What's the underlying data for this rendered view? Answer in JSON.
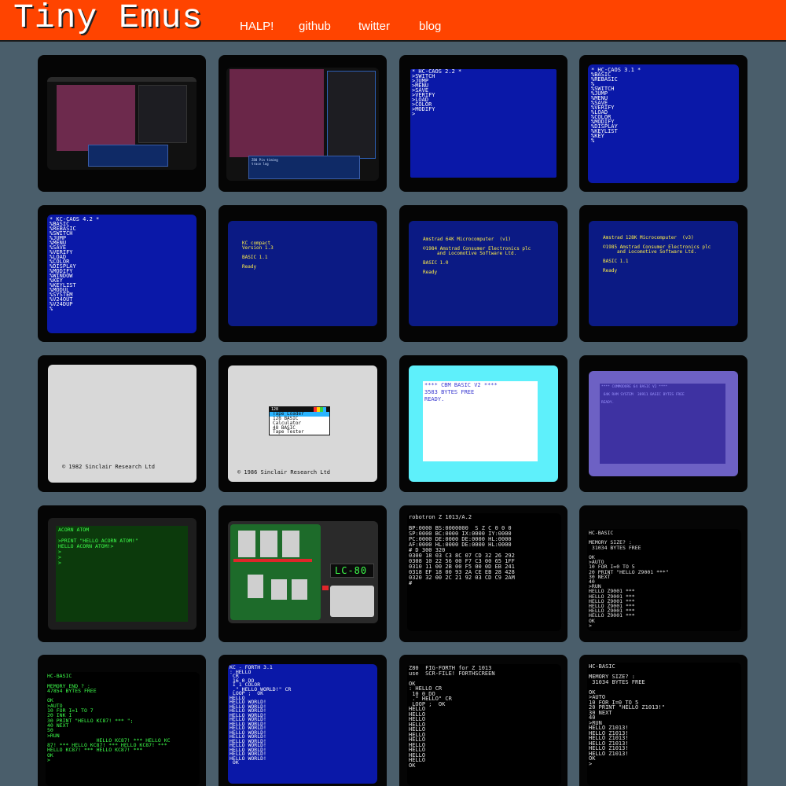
{
  "site": {
    "title": "Tiny Emus"
  },
  "nav": [
    {
      "label": "HALP!"
    },
    {
      "label": "github"
    },
    {
      "label": "twitter"
    },
    {
      "label": "blog"
    }
  ],
  "tiles": [
    {
      "text": ""
    },
    {
      "text": "Z80 Pin timing\ntrace log"
    },
    {
      "text": "* HC-CAOS 2.2 *\n>SWITCH\n>JUMP\n>MENU\n>SAVE\n>VERIFY\n>LOAD\n>COLOR\n>MODIFY\n>"
    },
    {
      "text": "* HC-CAOS 3.1 *\n%BASIC\n%REBASIC\n%\n%SWITCH\n%JUMP\n%MENU\n%SAVE\n%VERIFY\n%LOAD\n%COLOR\n%MODIFY\n%DISPLAY\n%KEYLIST\n%KEY\n%"
    },
    {
      "text": "* KC-CAOS 4.2 *\n%BASIC\n%REBASIC\n%SWITCH\n%JUMP\n%MENU\n%SAVE\n%VERIFY\n%LOAD\n%COLOR\n%DISPLAY\n%MODIFY\n%WINDOW\n%KEY\n%KEYLIST\n%MODUL\n%SYSTEM\n%V24OUT\n%V24DUP\n%"
    },
    {
      "text": "KC compact\nVersion 1.3\n\nBASIC 1.1\n\nReady"
    },
    {
      "text": "Amstrad 64K Microcomputer  (v1)\n\n©1984 Amstrad Consumer Electronics plc\n     and Locomotive Software Ltd.\n\nBASIC 1.0\n\nReady"
    },
    {
      "text": "Amstrad 128K Microcomputer  (v3)\n\n©1985 Amstrad Consumer Electronics plc\n     and Locomotive Software Ltd.\n\nBASIC 1.1\n\nReady"
    },
    {
      "text": "© 1982 Sinclair Research Ltd"
    },
    {
      "text": "© 1986 Sinclair Research Ltd",
      "menu": [
        "128",
        "Tape Loader",
        "128 BASIC",
        "Calculator",
        "48 BASIC",
        "Tape Tester"
      ]
    },
    {
      "text": "**** CBM BASIC V2 ****\n3583 BYTES FREE\nREADY."
    },
    {
      "text": "**** COMMODORE 64 BASIC V2 ****\n\n 64K RAM SYSTEM  38911 BASIC BYTES FREE\n\nREADY."
    },
    {
      "text": "ACORN ATOM\n\n>PRINT \"HELLO ACORN ATOM!\"\nHELLO ACORN ATOM!>\n>\n>\n>"
    },
    {
      "text": "LC-80"
    },
    {
      "text": "robotron Z 1013/A.2\n\nBP:0000 BS:0000000  S Z C 0 0 0\nSP:0000 BC:0000 IX:0000 IY:0000\nPC:0000 DE:0000 DE:0000 HL:0000\nAF:0000 HL:0000 DE:0000 HL:0000\n# D 300 320\n0300 18 03 C3 8C 07 CD 32 26 292\n0308 10 22 56 00 F7 C3 00 65 1FF\n0310 11 00 2B 00 F5 00 0D EB 241\n0318 EF 18 00 93 2A CE EB 28 428\n0320 32 00 2C 21 92 03 CD C9 2AM\n# "
    },
    {
      "text": "HC-BASIC\n\nMEMORY SIZE? :\n 31034 BYTES FREE\n\nOK\n>AUTO\n10 FOR I=0 TO 5\n20 PRINT \"HELLO Z9001 ***\"\n30 NEXT\n40\n>RUN\nHELLO Z9001 ***\nHELLO Z9001 ***\nHELLO Z9001 ***\nHELLO Z9001 ***\nHELLO Z9001 ***\nHELLO Z9001 ***\nOK\n>"
    },
    {
      "text": "HC-BASIC\n\nMEMORY END ? :\n47854 BYTES FREE\n\nOK\n>AUTO\n10 FOR I=1 TO 7\n20 INK I\n30 PRINT \"HELLO KC87! *** \";\n40 NEXT\n50\n>RUN\n                HELLO KC87! *** HELLO KC\n87! *** HELLO KC87! *** HELLO KC87! ***\nHELLO KC87! *** HELLO KC87! ***\nOK\n>"
    },
    {
      "text": "KC - FORTH 3.1\n: HELLO\n CR\n 16 0 DO\n I 1 COLOR\n .\" HELLO WORLD!\" CR\n LOOP ;  OK\nHELLO\nHELLO WORLD!\nHELLO WORLD!\nHELLO WORLD!\nHELLO WORLD!\nHELLO WORLD!\nHELLO WORLD!\nHELLO WORLD!\nHELLO WORLD!\nHELLO WORLD!\nHELLO WORLD!\nHELLO WORLD!\nHELLO WORLD!\nHELLO WORLD!\nHELLO WORLD!\n OK"
    },
    {
      "text": "Z80  FIG-FORTH for Z 1013\nuse  SCR-FILE! FORTHSCREEN\n\nOK\n: HELLO CR\n 10 0 DO\n .\" HELLO\" CR\n LOOP ;  OK\nHELLO\nHELLO\nHELLO\nHELLO\nHELLO\nHELLO\nHELLO\nHELLO\nHELLO\nHELLO\nHELLO\nOK"
    },
    {
      "text": "HC-BASIC\n\nMEMORY SIZE? :\n 31034 BYTES FREE\n\nOK\n>AUTO\n10 FOR I=0 TO 5\n20 PRINT \"HELLO Z1013!\"\n30 NEXT\n40\n>RUN\nHELLO Z1013!\nHELLO Z1013!\nHELLO Z1013!\nHELLO Z1013!\nHELLO Z1013!\nHELLO Z1013!\nOK\n>"
    }
  ],
  "colors": {
    "header": "#ff4400",
    "page": "#4a5e6b",
    "kc_blue": "#0a18a8",
    "cpc_blue": "#0b1a84",
    "zx_grey": "#d8d8d8",
    "vic_cyan": "#5ef0fb",
    "c64_purple": "#6d61c4",
    "atom_green": "#0c3a0c"
  }
}
